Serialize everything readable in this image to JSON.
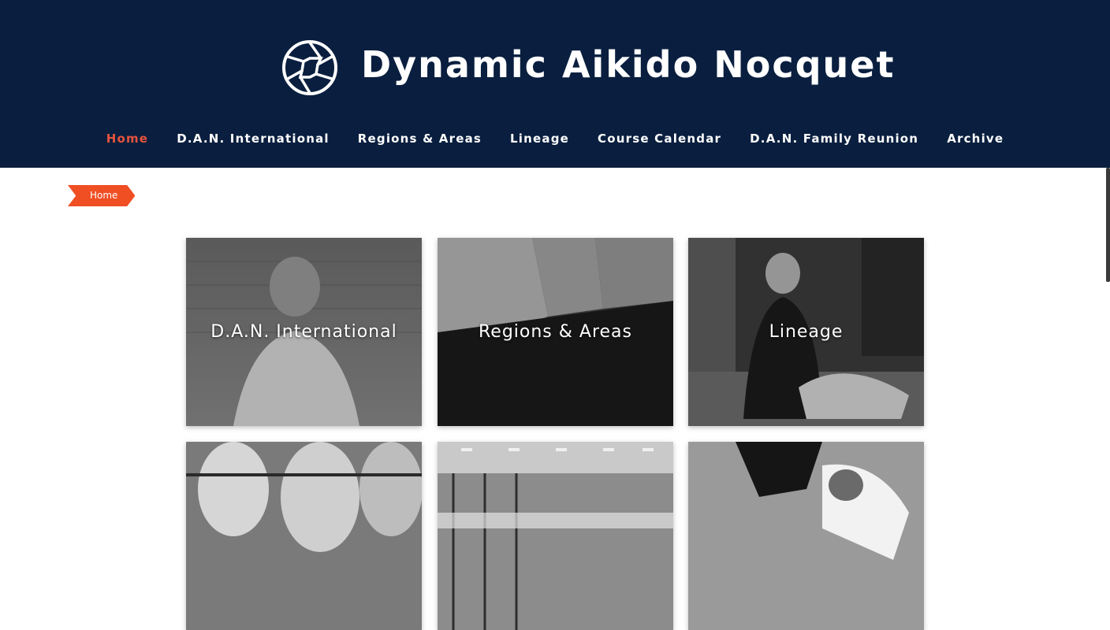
{
  "site": {
    "title": "Dynamic Aikido Nocquet"
  },
  "nav": {
    "items": [
      {
        "label": "Home",
        "active": true
      },
      {
        "label": "D.A.N. International",
        "active": false
      },
      {
        "label": "Regions & Areas",
        "active": false
      },
      {
        "label": "Lineage",
        "active": false
      },
      {
        "label": "Course Calendar",
        "active": false
      },
      {
        "label": "D.A.N. Family Reunion",
        "active": false
      },
      {
        "label": "Archive",
        "active": false
      }
    ]
  },
  "breadcrumb": {
    "items": [
      "Home"
    ]
  },
  "tiles": [
    {
      "label": "D.A.N. International"
    },
    {
      "label": "Regions & Areas"
    },
    {
      "label": "Lineage"
    },
    {
      "label": ""
    },
    {
      "label": ""
    },
    {
      "label": ""
    }
  ],
  "colors": {
    "header_bg": "#0a1f3f",
    "accent": "#f04e23",
    "nav_active": "#e5533d"
  }
}
